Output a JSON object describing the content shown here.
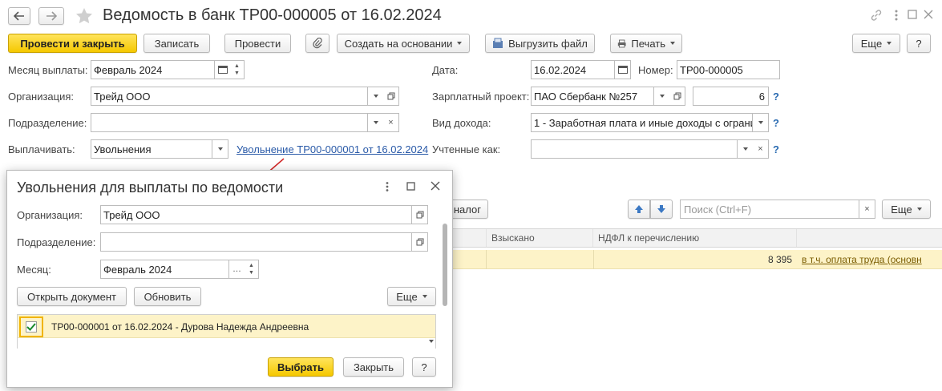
{
  "window": {
    "title": "Ведомость в банк ТР00-000005 от 16.02.2024",
    "more_icon": "ellipsis-vertical-icon"
  },
  "toolbar": {
    "post_close": "Провести и закрыть",
    "save": "Записать",
    "post": "Провести",
    "create_based": "Создать на основании",
    "export_file": "Выгрузить файл",
    "print": "Печать",
    "more": "Еще",
    "help": "?"
  },
  "form": {
    "month_label": "Месяц выплаты:",
    "month_value": "Февраль 2024",
    "org_label": "Организация:",
    "org_value": "Трейд ООО",
    "dept_label": "Подразделение:",
    "dept_value": "",
    "pay_label": "Выплачивать:",
    "pay_value": "Увольнения",
    "pay_link": "Увольнение ТР00-000001 от 16.02.2024",
    "date_label": "Дата:",
    "date_value": "16.02.2024",
    "number_label": "Номер:",
    "number_value": "ТР00-000005",
    "salary_project_label": "Зарплатный проект:",
    "salary_project_value": "ПАО Сбербанк №257",
    "salary_project_num": "6",
    "income_label": "Вид дохода:",
    "income_value": "1 - Заработная плата и иные доходы с ограни",
    "accounted_label": "Учтенные как:",
    "accounted_value": "",
    "help": "?"
  },
  "table_toolbar": {
    "tax_btn": "налог",
    "search_placeholder": "Поиск (Ctrl+F)",
    "more": "Еще"
  },
  "table": {
    "col_collected": "Взыскано",
    "col_ndfl": "НДФЛ к перечислению",
    "row_ndfl": "8 395",
    "row_link": "в т.ч. оплата труда (основн"
  },
  "dialog": {
    "title": "Увольнения для выплаты по ведомости",
    "org_label": "Организация:",
    "org_value": "Трейд ООО",
    "dept_label": "Подразделение:",
    "dept_value": "",
    "month_label": "Месяц:",
    "month_value": "Февраль 2024",
    "open_doc": "Открыть документ",
    "refresh": "Обновить",
    "more": "Еще",
    "row_text": "ТР00-000001 от 16.02.2024 - Дурова Надежда Андреевна",
    "select": "Выбрать",
    "close": "Закрыть",
    "help": "?"
  },
  "colors": {
    "accent_yellow": "#f5c800",
    "row_highlight": "#fdf3c8",
    "link_blue": "#2a5aa8",
    "arrow_red": "#d22b2b"
  }
}
